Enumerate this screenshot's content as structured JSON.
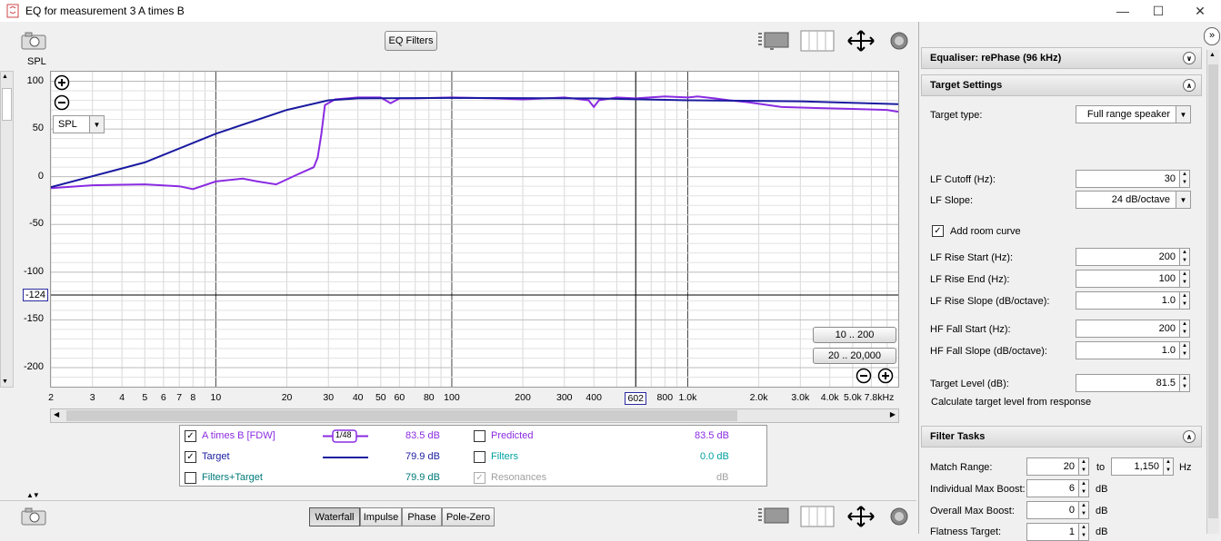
{
  "window": {
    "title": "EQ for measurement 3 A times B"
  },
  "toolbar": {
    "eq_filters_label": "EQ Filters",
    "spl_axis_label": "SPL",
    "spl_select_value": "SPL"
  },
  "graph": {
    "y_ticks": [
      "100",
      "50",
      "0",
      "-50",
      "-100",
      "-124",
      "-150",
      "-200"
    ],
    "x_ticks": [
      "2",
      "3",
      "4",
      "5",
      "6",
      "7",
      "8",
      "10",
      "20",
      "30",
      "40",
      "50",
      "60",
      "80",
      "100",
      "200",
      "300",
      "400",
      "602",
      "800",
      "1.0k",
      "2.0k",
      "3.0k",
      "4.0k",
      "5.0k",
      "7.8kHz"
    ],
    "range_btn_1": "10 .. 200",
    "range_btn_2": "20 .. 20,000",
    "cursor_y": "-124",
    "cursor_x": "602"
  },
  "chart_data": {
    "type": "line",
    "x_scale": "log",
    "xlim": [
      2,
      7800
    ],
    "ylim": [
      -220,
      110
    ],
    "series": [
      {
        "name": "A times B [FDW]",
        "color": "#8a2be2",
        "x": [
          2,
          3,
          5,
          7,
          8,
          10,
          13,
          15,
          18,
          22,
          26,
          27,
          28,
          29,
          32,
          40,
          50,
          55,
          60,
          70,
          100,
          150,
          200,
          300,
          380,
          400,
          420,
          500,
          600,
          800,
          1000,
          1100,
          1300,
          1500,
          1800,
          2500,
          3500,
          5000,
          7000,
          7800
        ],
        "y": [
          -12,
          -9,
          -8,
          -10,
          -13,
          -5,
          -2,
          -5,
          -8,
          2,
          10,
          20,
          45,
          75,
          81,
          83,
          83,
          77,
          82,
          82,
          83,
          82,
          81,
          83,
          80,
          73,
          80,
          83,
          82,
          84,
          83,
          84,
          82,
          80,
          78,
          73,
          72,
          71,
          70,
          68
        ]
      },
      {
        "name": "Target",
        "color": "#1a1aa0",
        "x": [
          2,
          5,
          10,
          20,
          30,
          40,
          100,
          400,
          1000,
          3000,
          7800
        ],
        "y": [
          -11,
          15,
          45,
          70,
          80,
          82,
          82.5,
          82,
          80,
          79,
          76
        ]
      }
    ]
  },
  "legend": {
    "rows": [
      {
        "checked": true,
        "name": "A times B [FDW]",
        "smoothing": "1/48",
        "value": "83.5 dB",
        "color": "#8a2be2",
        "line": false
      },
      {
        "checked": true,
        "name": "Target",
        "value": "79.9 dB",
        "color": "#1a1aa0",
        "line": true
      },
      {
        "checked": false,
        "name": "Filters+Target",
        "value": "79.9 dB",
        "color": "#007a7a",
        "line": false
      }
    ],
    "rows_right": [
      {
        "checked": false,
        "name": "Predicted",
        "value": "83.5 dB",
        "color": "#8a2be2"
      },
      {
        "checked": false,
        "name": "Filters",
        "value": "0.0 dB",
        "color": "#00a0a0"
      },
      {
        "checked": true,
        "name": "Resonances",
        "value": "dB",
        "color": "#a0a0a0"
      }
    ]
  },
  "bottom_tabs": [
    "Waterfall",
    "Impulse",
    "Phase",
    "Pole-Zero"
  ],
  "right_panel": {
    "equaliser_header": "Equaliser: rePhase (96 kHz)",
    "target_header": "Target Settings",
    "target_type_label": "Target type:",
    "target_type_value": "Full range speaker",
    "lf_cutoff_label": "LF Cutoff (Hz):",
    "lf_cutoff_value": "30",
    "lf_slope_label": "LF Slope:",
    "lf_slope_value": "24 dB/octave",
    "room_curve_label": "Add room curve",
    "lf_rise_start_label": "LF Rise Start (Hz):",
    "lf_rise_start_value": "200",
    "lf_rise_end_label": "LF Rise End (Hz):",
    "lf_rise_end_value": "100",
    "lf_rise_slope_label": "LF Rise Slope (dB/octave):",
    "lf_rise_slope_value": "1.0",
    "hf_fall_start_label": "HF Fall Start (Hz):",
    "hf_fall_start_value": "200",
    "hf_fall_slope_label": "HF Fall Slope (dB/octave):",
    "hf_fall_slope_value": "1.0",
    "target_level_label": "Target Level (dB):",
    "target_level_value": "81.5",
    "calc_target_label": "Calculate target level from response",
    "filter_tasks_header": "Filter Tasks",
    "match_range_label": "Match Range:",
    "match_range_from": "20",
    "match_range_to_label": "to",
    "match_range_to": "1,150",
    "match_range_unit": "Hz",
    "indiv_boost_label": "Individual Max Boost:",
    "indiv_boost_value": "6",
    "indiv_boost_unit": "dB",
    "overall_boost_label": "Overall Max Boost:",
    "overall_boost_value": "0",
    "overall_boost_unit": "dB",
    "flatness_label": "Flatness Target:",
    "flatness_value": "1",
    "flatness_unit": "dB"
  },
  "colors": {
    "accent_purple": "#8a2be2",
    "target_blue": "#1a1aa0",
    "teal": "#007a7a"
  }
}
